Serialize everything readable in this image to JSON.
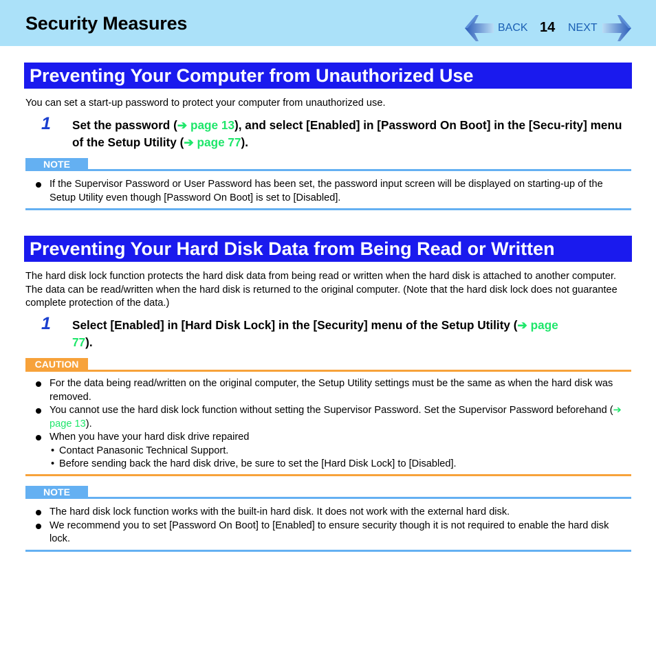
{
  "header": {
    "title": "Security Measures",
    "nav": {
      "back_label": "BACK",
      "page_number": "14",
      "next_label": "NEXT"
    }
  },
  "colors": {
    "header_bg": "#abe1f9",
    "section_title_bg": "#1a1aee",
    "link": "#1ee66a",
    "step_number": "#1a3fcf",
    "note": "#64b0f2",
    "caution": "#f7a23a"
  },
  "section1": {
    "title": "Preventing Your Computer from Unauthorized Use",
    "intro": "You can set a start-up password to protect your computer from unauthorized use.",
    "step": {
      "number": "1",
      "text_a": "Set the password (",
      "link1": "page 13",
      "text_b": "), and select [Enabled] in [Password On Boot] in the [Secu-rity] menu of the Setup Utility (",
      "link2": "page 77",
      "text_c": ")."
    },
    "note": {
      "label": "NOTE",
      "items": [
        "If the Supervisor Password or User Password has been set, the password input screen will be displayed on starting-up of the Setup Utility even though [Password On Boot] is set to [Disabled]."
      ]
    }
  },
  "section2": {
    "title": "Preventing Your Hard Disk Data from Being Read or Written",
    "intro": "The hard disk lock function protects the hard disk data from being read or written when the hard disk is attached to another computer. The data can be read/written when the hard disk is returned to the original computer. (Note that the hard disk lock does not guarantee complete protection of the data.)",
    "step": {
      "number": "1",
      "text_a": "Select [Enabled] in [Hard Disk Lock] in the [Security] menu of the Setup Utility (",
      "link1": "page 77",
      "text_b": ")."
    },
    "caution": {
      "label": "CAUTION",
      "items": [
        "For the data being read/written on the original computer, the Setup Utility settings must be the same as when the hard disk was removed.",
        "You cannot use the hard disk lock function without setting the Supervisor Password. Set the Supervisor Password beforehand (",
        "When you have your hard disk drive repaired"
      ],
      "item2_link": "page 13",
      "item2_end": ").",
      "sub_items": [
        "Contact Panasonic Technical Support.",
        "Before sending back the hard disk drive, be sure to set the [Hard Disk Lock] to [Disabled]."
      ]
    },
    "note": {
      "label": "NOTE",
      "items": [
        "The hard disk lock function works with the built-in hard disk. It does not work with the external hard disk.",
        "We recommend you to set [Password On Boot] to [Enabled] to ensure security though it is not required to enable the hard disk lock."
      ]
    }
  },
  "icons": {
    "link_arrow": "➔"
  }
}
